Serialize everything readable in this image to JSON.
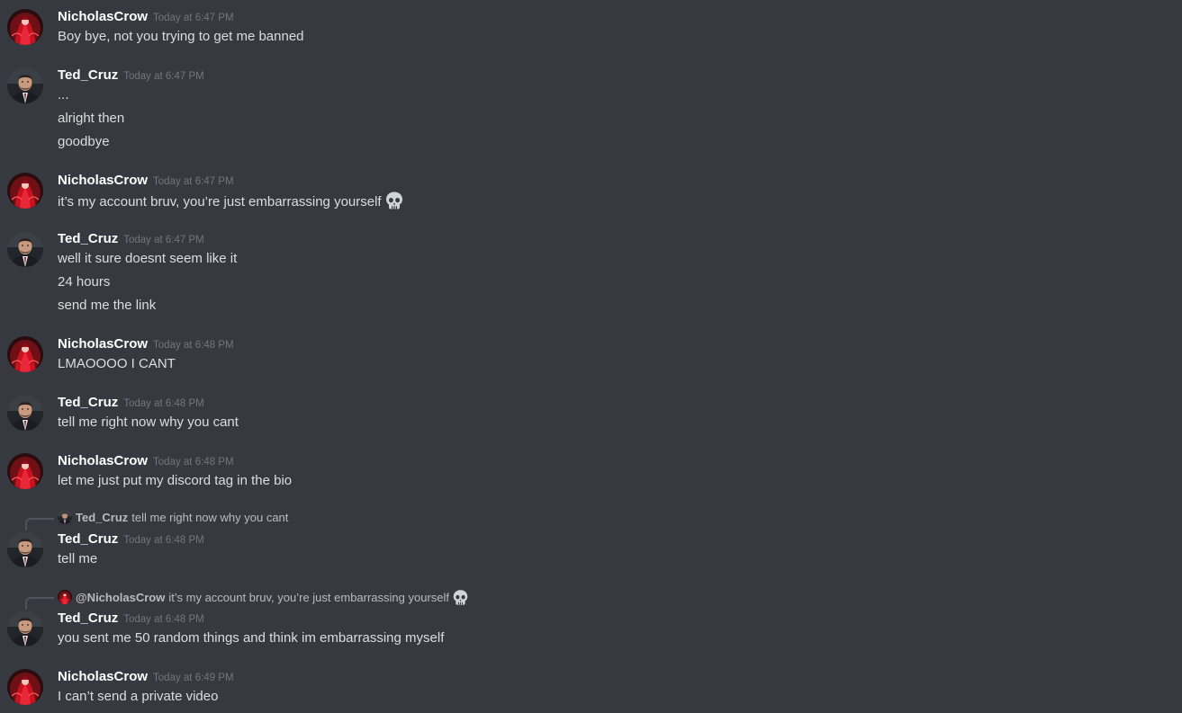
{
  "messages": [
    {
      "author": "NicholasCrow",
      "avatar": "red-figure-avatar",
      "timestamp": "Today at 6:47 PM",
      "lines": [
        "Boy bye, not you trying to get me banned"
      ]
    },
    {
      "author": "Ted_Cruz",
      "avatar": "man-in-suit-avatar",
      "timestamp": "Today at 6:47 PM",
      "lines": [
        "...",
        "alright then",
        "goodbye"
      ]
    },
    {
      "author": "NicholasCrow",
      "avatar": "red-figure-avatar",
      "timestamp": "Today at 6:47 PM",
      "lines": [
        "it’s my account bruv, you’re just embarrassing yourself"
      ],
      "emoji": "skull-emoji"
    },
    {
      "author": "Ted_Cruz",
      "avatar": "man-in-suit-avatar",
      "timestamp": "Today at 6:47 PM",
      "lines": [
        "well it sure doesnt seem like it",
        "24 hours",
        "send me the link"
      ]
    },
    {
      "author": "NicholasCrow",
      "avatar": "red-figure-avatar",
      "timestamp": "Today at 6:48 PM",
      "lines": [
        "LMAOOOO I CANT"
      ]
    },
    {
      "author": "Ted_Cruz",
      "avatar": "man-in-suit-avatar",
      "timestamp": "Today at 6:48 PM",
      "lines": [
        "tell me right now why you cant"
      ]
    },
    {
      "author": "NicholasCrow",
      "avatar": "red-figure-avatar",
      "timestamp": "Today at 6:48 PM",
      "lines": [
        "let me just put my discord tag in the bio"
      ]
    },
    {
      "reply_to": {
        "author": "Ted_Cruz",
        "text": "tell me right now why you cant"
      },
      "author": "Ted_Cruz",
      "avatar": "man-in-suit-avatar",
      "timestamp": "Today at 6:48 PM",
      "lines": [
        "tell me"
      ]
    },
    {
      "reply_to": {
        "author": "@NicholasCrow",
        "text": "it’s my account bruv, you’re just embarrassing yourself",
        "emoji": "skull-emoji"
      },
      "author": "Ted_Cruz",
      "avatar": "man-in-suit-avatar",
      "timestamp": "Today at 6:48 PM",
      "lines": [
        "you sent me 50 random things and think im embarrassing myself"
      ]
    },
    {
      "author": "NicholasCrow",
      "avatar": "red-figure-avatar",
      "timestamp": "Today at 6:49 PM",
      "lines": [
        "I can’t send a private video"
      ]
    }
  ],
  "colors": {
    "background": "#36393f",
    "username": "#ffffff",
    "timestamp": "#72767d",
    "message_text": "#dcddde",
    "reply_text": "#b9bbbe"
  }
}
